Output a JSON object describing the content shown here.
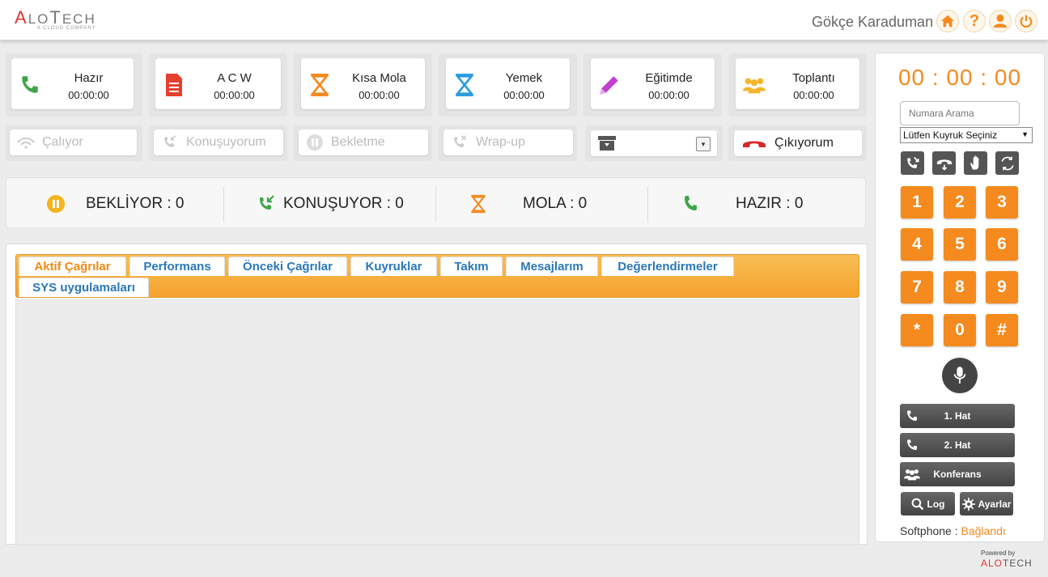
{
  "header": {
    "logo": {
      "prefix": "A",
      "l": "L",
      "o": "O",
      "t": "T",
      "ech": "ECH",
      "tagline": "A CLOUD COMPANY"
    },
    "user_name": "Gökçe Karaduman",
    "buttons": [
      {
        "icon": "home-icon"
      },
      {
        "icon": "help-icon",
        "glyph": "?"
      },
      {
        "icon": "user-icon"
      },
      {
        "icon": "power-icon"
      }
    ],
    "accent_color": "#f58a1f"
  },
  "status_cards": [
    {
      "label": "Hazır",
      "time": "00:00:00",
      "icon": "phone-icon"
    },
    {
      "label": "A C W",
      "time": "00:00:00",
      "icon": "document-icon"
    },
    {
      "label": "Kısa Mola",
      "time": "00:00:00",
      "icon": "hourglass-icon"
    },
    {
      "label": "Yemek",
      "time": "00:00:00",
      "icon": "hourglass-blue-icon"
    },
    {
      "label": "Eğitimde",
      "time": "00:00:00",
      "icon": "pencil-icon"
    },
    {
      "label": "Toplantı",
      "time": "00:00:00",
      "icon": "group-icon"
    }
  ],
  "call_states": [
    {
      "label": "Çalıyor",
      "icon": "ringing-icon"
    },
    {
      "label": "Konuşuyorum",
      "icon": "incoming-call-icon"
    },
    {
      "label": "Bekletme",
      "icon": "pause-icon"
    },
    {
      "label": "Wrap-up",
      "icon": "missed-call-icon"
    }
  ],
  "exit_button": {
    "label": "Çıkıyorum"
  },
  "summary": [
    {
      "label": "BEKLİYOR : 0",
      "icon": "pause-circle-icon"
    },
    {
      "label": "KONUŞUYOR : 0",
      "icon": "incoming-call-icon"
    },
    {
      "label": "MOLA : 0",
      "icon": "hourglass-icon"
    },
    {
      "label": "HAZIR : 0",
      "icon": "phone-icon"
    }
  ],
  "tabs": [
    {
      "label": "Aktif Çağrılar",
      "active": true
    },
    {
      "label": "Performans"
    },
    {
      "label": "Önceki Çağrılar"
    },
    {
      "label": "Kuyruklar"
    },
    {
      "label": "Takım"
    },
    {
      "label": "Mesajlarım"
    },
    {
      "label": "Değerlendirmeler"
    },
    {
      "label": "SYS uygulamaları"
    }
  ],
  "softphone": {
    "timer": "00 : 00 : 00",
    "search_placeholder": "Numara Arama",
    "queue_select": "Lütfen Kuyruk Seçiniz",
    "keys": [
      "1",
      "2",
      "3",
      "4",
      "5",
      "6",
      "7",
      "8",
      "9",
      "*",
      "0",
      "#"
    ],
    "lines": [
      {
        "label": "1. Hat"
      },
      {
        "label": "2. Hat"
      },
      {
        "label": "Konferans"
      }
    ],
    "log_label": "Log",
    "settings_label": "Ayarlar",
    "status_label": "Softphone :",
    "status_value": "Bağlandı"
  },
  "footer": {
    "powered_by": "Powered by",
    "logo_red": "ALO",
    "logo_grey": "TECH"
  }
}
